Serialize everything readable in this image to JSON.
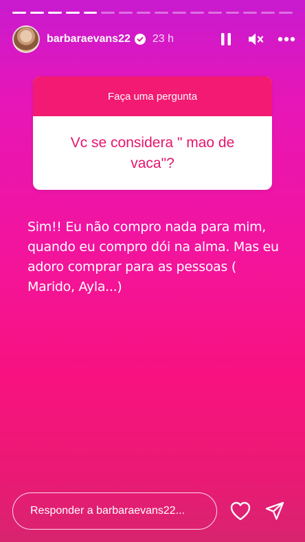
{
  "progress": {
    "total_segments": 16,
    "completed_segments": 5
  },
  "header": {
    "avatar_icon": "avatar",
    "username": "barbaraevans22",
    "verified_icon": "verified-badge-icon",
    "time_ago": "23 h",
    "pause_icon": "pause-icon",
    "mute_icon": "muted-speaker-icon",
    "more_icon": "more-horizontal-icon"
  },
  "question_sticker": {
    "prompt": "Faça uma pergunta",
    "question": "Vc se considera \" mao de vaca\"?",
    "header_color": "#f21a72",
    "text_color": "#e5156d"
  },
  "answer_text": "Sim!! Eu não compro nada para mim, quando eu compro dói na alma. Mas eu adoro comprar para as pessoas ( Marido, Ayla...)",
  "footer": {
    "reply_placeholder": "Responder a barbaraevans22...",
    "like_icon": "heart-icon",
    "send_icon": "send-icon"
  },
  "colors": {
    "background_top": "#c81bd0",
    "background_bottom": "#f8127f"
  }
}
